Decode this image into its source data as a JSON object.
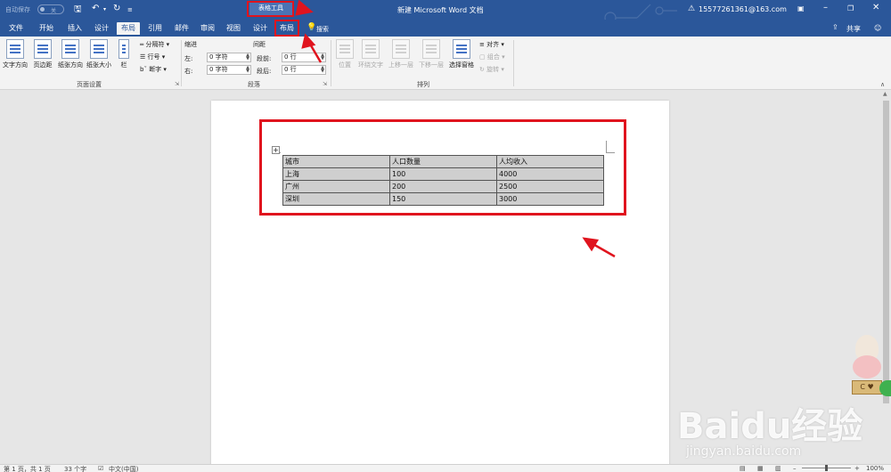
{
  "titlebar": {
    "autosave_label": "自动保存",
    "autosave_state": "关",
    "context_tools": "表格工具",
    "doc_title": "新建 Microsoft Word 文档",
    "account": "15577261361@163.com"
  },
  "tabs": [
    "文件",
    "开始",
    "插入",
    "设计",
    "布局",
    "引用",
    "邮件",
    "审阅",
    "视图",
    "设计",
    "布局"
  ],
  "search": {
    "label": "搜索"
  },
  "share": {
    "label": "共享"
  },
  "ribbon": {
    "page_setup": {
      "text_direction": "文字方向",
      "margins": "页边距",
      "orientation": "纸张方向",
      "size": "纸张大小",
      "columns": "栏",
      "breaks": "分隔符",
      "line_numbers": "行号",
      "hyphenation": "断字",
      "group_label": "页面设置"
    },
    "paragraph": {
      "indent_title": "缩进",
      "spacing_title": "间距",
      "left_label": "左:",
      "left_value": "0 字符",
      "right_label": "右:",
      "right_value": "0 字符",
      "before_label": "段前:",
      "before_value": "0 行",
      "after_label": "段后:",
      "after_value": "0 行",
      "group_label": "段落"
    },
    "arrange": {
      "position": "位置",
      "wrap_text": "环绕文字",
      "bring_forward": "上移一层",
      "send_backward": "下移一层",
      "selection_pane": "选择窗格",
      "align": "对齐",
      "group": "组合",
      "rotate": "旋转",
      "group_label": "排列"
    }
  },
  "table": {
    "headers": [
      "城市",
      "人口数量",
      "人均收入"
    ],
    "rows": [
      [
        "上海",
        "100",
        "4000"
      ],
      [
        "广州",
        "200",
        "2500"
      ],
      [
        "深圳",
        "150",
        "3000"
      ]
    ]
  },
  "status": {
    "page": "第 1 页，共 1 页",
    "words": "33 个字",
    "language": "中文(中国)",
    "zoom": "100%"
  },
  "watermark": {
    "brand": "Baidu经验",
    "url": "jingyan.baidu.com"
  },
  "colors": {
    "title_blue": "#2b579a",
    "ribbon_bg": "#f3f3f3",
    "annotation_red": "#e0141e",
    "table_fill": "#cfcfcf"
  }
}
